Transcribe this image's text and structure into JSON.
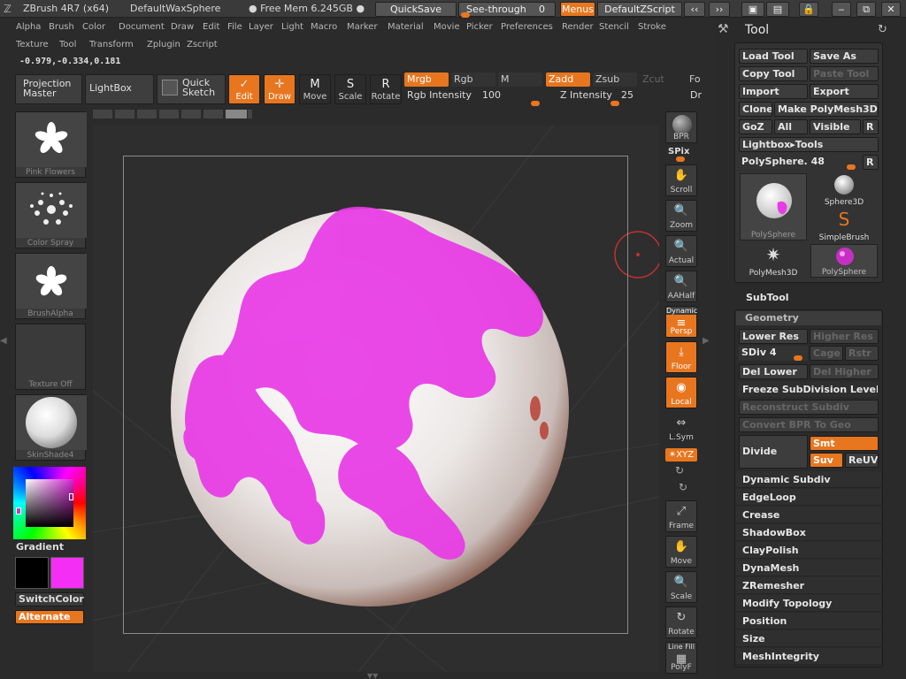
{
  "titlebar": {
    "app": "ZBrush 4R7 (x64)",
    "document": "DefaultWaxSphere",
    "mem": "● Free Mem 6.245GB ●",
    "quicksave": "QuickSave",
    "seethrough_label": "See-through",
    "seethrough_value": "0",
    "menus": "Menus",
    "zscript": "DefaultZScript"
  },
  "menus": {
    "row1": [
      "Alpha",
      "Brush",
      "Color",
      "Document",
      "Draw",
      "Edit",
      "File",
      "Layer",
      "Light",
      "Macro",
      "Marker",
      "Material",
      "Movie",
      "Picker",
      "Preferences",
      "Render",
      "Stencil",
      "Stroke"
    ],
    "row2": [
      "Texture",
      "Tool",
      "Transform",
      "Zplugin",
      "Zscript"
    ]
  },
  "coords": "-0.979,-0.334,0.181",
  "shelf": {
    "projection_master": "Projection\nMaster",
    "lightbox": "LightBox",
    "quick_sketch": "Quick\nSketch",
    "edit": "Edit",
    "draw": "Draw",
    "move": "Move",
    "scale": "Scale",
    "rotate": "Rotate",
    "mrgb": "Mrgb",
    "rgb": "Rgb",
    "m": "M",
    "zadd": "Zadd",
    "zsub": "Zsub",
    "zcut": "Zcut",
    "fo": "Fo",
    "rgb_intensity_label": "Rgb Intensity",
    "rgb_intensity_value": "100",
    "z_intensity_label": "Z Intensity",
    "z_intensity_value": "25",
    "dr": "Dr"
  },
  "left": {
    "brush_cap": "Pink Flowers",
    "spray_cap": "Color Spray",
    "alpha_cap": "BrushAlpha",
    "texture_cap": "Texture Off",
    "material_cap": "SkinShade4",
    "gradient": "Gradient",
    "switchcolor": "SwitchColor",
    "alternate": "Alternate",
    "primary_color": "#000000",
    "secondary_color": "#f52ef5"
  },
  "rightshelf": {
    "bpr": "BPR",
    "spix": "SPix",
    "scroll": "Scroll",
    "zoom": "Zoom",
    "actual": "Actual",
    "aahalf": "AAHalf",
    "dynamic": "Dynamic",
    "persp": "Persp",
    "floor": "Floor",
    "local": "Local",
    "lsym": "L.Sym",
    "xyz": "✴XYZ",
    "frame": "Frame",
    "move": "Move",
    "scale": "Scale",
    "rotate": "Rotate",
    "linefill": "Line Fill",
    "polyf": "PolyF"
  },
  "tool_palette": {
    "title": "Tool",
    "load_tool": "Load Tool",
    "save_as": "Save As",
    "copy_tool": "Copy Tool",
    "paste_tool": "Paste Tool",
    "import": "Import",
    "export": "Export",
    "clone": "Clone",
    "make_polymesh": "Make PolyMesh3D",
    "goz": "GoZ",
    "all": "All",
    "visible": "Visible",
    "r": "R",
    "lightbox_tools": "Lightbox▸Tools",
    "polysphere_label": "PolySphere.",
    "polysphere_value": "48",
    "thumbs": [
      "PolySphere",
      "Sphere3D",
      "SimpleBrush",
      "PolyMesh3D",
      "PolySphere"
    ],
    "subtool": "SubTool",
    "geometry": "Geometry",
    "lower_res": "Lower Res",
    "higher_res": "Higher Res",
    "sdiv_label": "SDiv",
    "sdiv_value": "4",
    "cage": "Cage",
    "rstr": "Rstr",
    "del_lower": "Del Lower",
    "del_higher": "Del Higher",
    "freeze": "Freeze SubDivision Levels",
    "reconstruct": "Reconstruct Subdiv",
    "convert_bpr": "Convert BPR To Geo",
    "divide": "Divide",
    "smt": "Smt",
    "suv": "Suv",
    "reuv": "ReUV",
    "sections": [
      "Dynamic Subdiv",
      "EdgeLoop",
      "Crease",
      "ShadowBox",
      "ClayPolish",
      "DynaMesh",
      "ZRemesher",
      "Modify Topology",
      "Position",
      "Size",
      "MeshIntegrity"
    ]
  }
}
